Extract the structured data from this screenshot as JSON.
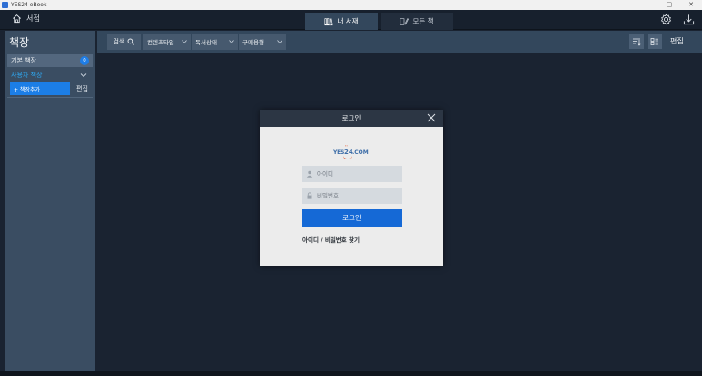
{
  "window": {
    "title": "YES24 eBook",
    "controls": [
      "—",
      "▢",
      "✕"
    ]
  },
  "header": {
    "home_label": "서점",
    "tabs": [
      {
        "label": "내 서재",
        "icon": "bookshelf-icon",
        "active": true
      },
      {
        "label": "모든 책",
        "icon": "book-pen-icon",
        "active": false
      }
    ],
    "right_icons": [
      "settings-icon",
      "download-icon"
    ]
  },
  "sidebar": {
    "title": "책장",
    "default_shelf": {
      "label": "기본 책장",
      "count": "0"
    },
    "user_shelf": {
      "label": "사용자 책장"
    },
    "add_button": "+ 책장추가",
    "edit_button": "편집"
  },
  "toolbar": {
    "search_label": "검색",
    "dropdowns": [
      "컨텐츠타입",
      "독서상태",
      "구매용형"
    ],
    "edit_label": "편집",
    "icons": [
      "sort-icon",
      "view-mode-icon"
    ]
  },
  "login": {
    "title": "로그인",
    "logo": {
      "part1": "YES",
      "part2": "24",
      "part3": ".COM"
    },
    "id_placeholder": "아이디",
    "pw_placeholder": "비밀번호",
    "submit_label": "로그인",
    "find_link": "아이디 / 비밀번호 찾기"
  },
  "colors": {
    "background": "#1a2331",
    "sidebar": "#3a4d62",
    "toolbar": "#33475c",
    "accent": "#1c7ee6",
    "link_blue": "#2ea7f0",
    "dialog_header": "#2c3644",
    "dialog_body": "#ececec"
  }
}
